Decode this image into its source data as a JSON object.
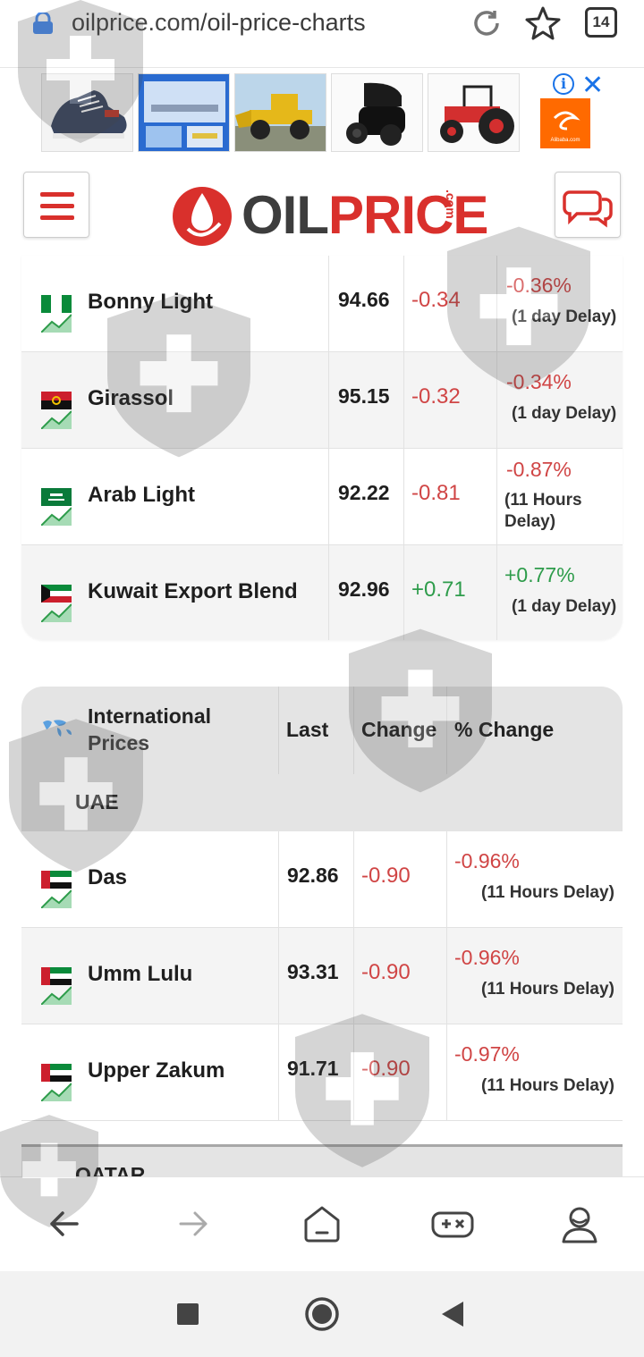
{
  "browser": {
    "url_host": "oilprice.com",
    "url_path": "/oil-price-charts",
    "tab_count": "14"
  },
  "ad": {
    "info_label": "i",
    "close_label": "✕",
    "products": [
      "shoe",
      "car-lift",
      "wheel-loader",
      "earbuds",
      "tractor"
    ],
    "brand": "Alibaba.com"
  },
  "site": {
    "logo_oil": "OIL",
    "logo_price": "PRICE",
    "logo_com": ".com"
  },
  "table1": {
    "rows": [
      {
        "name": "Bonny Light",
        "last": "94.66",
        "change": "-0.34",
        "pct": "-0.36%",
        "delay": "(1 day Delay)",
        "flag": "nigeria"
      },
      {
        "name": "Girassol",
        "last": "95.15",
        "change": "-0.32",
        "pct": "-0.34%",
        "delay": "(1 day Delay)",
        "flag": "angola"
      },
      {
        "name": "Arab Light",
        "last": "92.22",
        "change": "-0.81",
        "pct": "-0.87%",
        "delay": "(11 Hours Delay)",
        "flag": "saudi-arabia"
      },
      {
        "name": "Kuwait Export Blend",
        "last": "92.96",
        "change": "+0.71",
        "pct": "+0.77%",
        "delay": "(1 day Delay)",
        "flag": "kuwait"
      }
    ]
  },
  "table2": {
    "header": {
      "title_line1": "International",
      "title_line2": "Prices",
      "last": "Last",
      "change": "Change",
      "pct": "% Change"
    },
    "region": "UAE",
    "next_region": "QATAR",
    "rows": [
      {
        "name": "Das",
        "last": "92.86",
        "change": "-0.90",
        "pct": "-0.96%",
        "delay": "(11 Hours Delay)",
        "flag": "uae"
      },
      {
        "name": "Umm Lulu",
        "last": "93.31",
        "change": "-0.90",
        "pct": "-0.96%",
        "delay": "(11 Hours Delay)",
        "flag": "uae"
      },
      {
        "name": "Upper Zakum",
        "last": "91.71",
        "change": "-0.90",
        "pct": "-0.97%",
        "delay": "(11 Hours Delay)",
        "flag": "uae"
      }
    ]
  },
  "colors": {
    "negative": "#d04545",
    "positive": "#2e9c4b",
    "brand_red": "#d9302c"
  }
}
